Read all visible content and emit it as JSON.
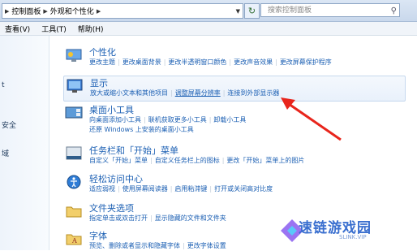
{
  "address": {
    "crumbs": [
      "控制面板",
      "外观和个性化"
    ],
    "search_placeholder": "搜索控制面板"
  },
  "menu": [
    "查看(V)",
    "工具(T)",
    "帮助(H)"
  ],
  "left_pane": [
    "t",
    "安全",
    "域"
  ],
  "sections": [
    {
      "title": "个性化",
      "links": [
        "更改主题",
        "更改桌面背景",
        "更改半透明窗口颜色",
        "更改声音效果",
        "更改屏幕保护程序"
      ]
    },
    {
      "title": "显示",
      "links": [
        "放大或缩小文本和其他项目",
        "调整屏幕分辨率",
        "连接到外部显示器"
      ]
    },
    {
      "title": "桌面小工具",
      "links": [
        "向桌面添加小工具",
        "联机获取更多小工具",
        "卸载小工具"
      ],
      "links2": [
        "还原 Windows 上安装的桌面小工具"
      ]
    },
    {
      "title": "任务栏和「开始」菜单",
      "links": [
        "自定义「开始」菜单",
        "自定义任务栏上的图标",
        "更改「开始」菜单上的图片"
      ]
    },
    {
      "title": "轻松访问中心",
      "links": [
        "适应弱视",
        "使用屏幕阅读器",
        "启用粘滞键",
        "打开或关闭高对比度"
      ]
    },
    {
      "title": "文件夹选项",
      "links": [
        "指定单击或双击打开",
        "显示隐藏的文件和文件夹"
      ]
    },
    {
      "title": "字体",
      "links": [
        "预览、删除或者显示和隐藏字体",
        "更改字体设置"
      ]
    }
  ],
  "watermark": {
    "text": "速链游戏园",
    "sub": "SLINK.VIP"
  }
}
